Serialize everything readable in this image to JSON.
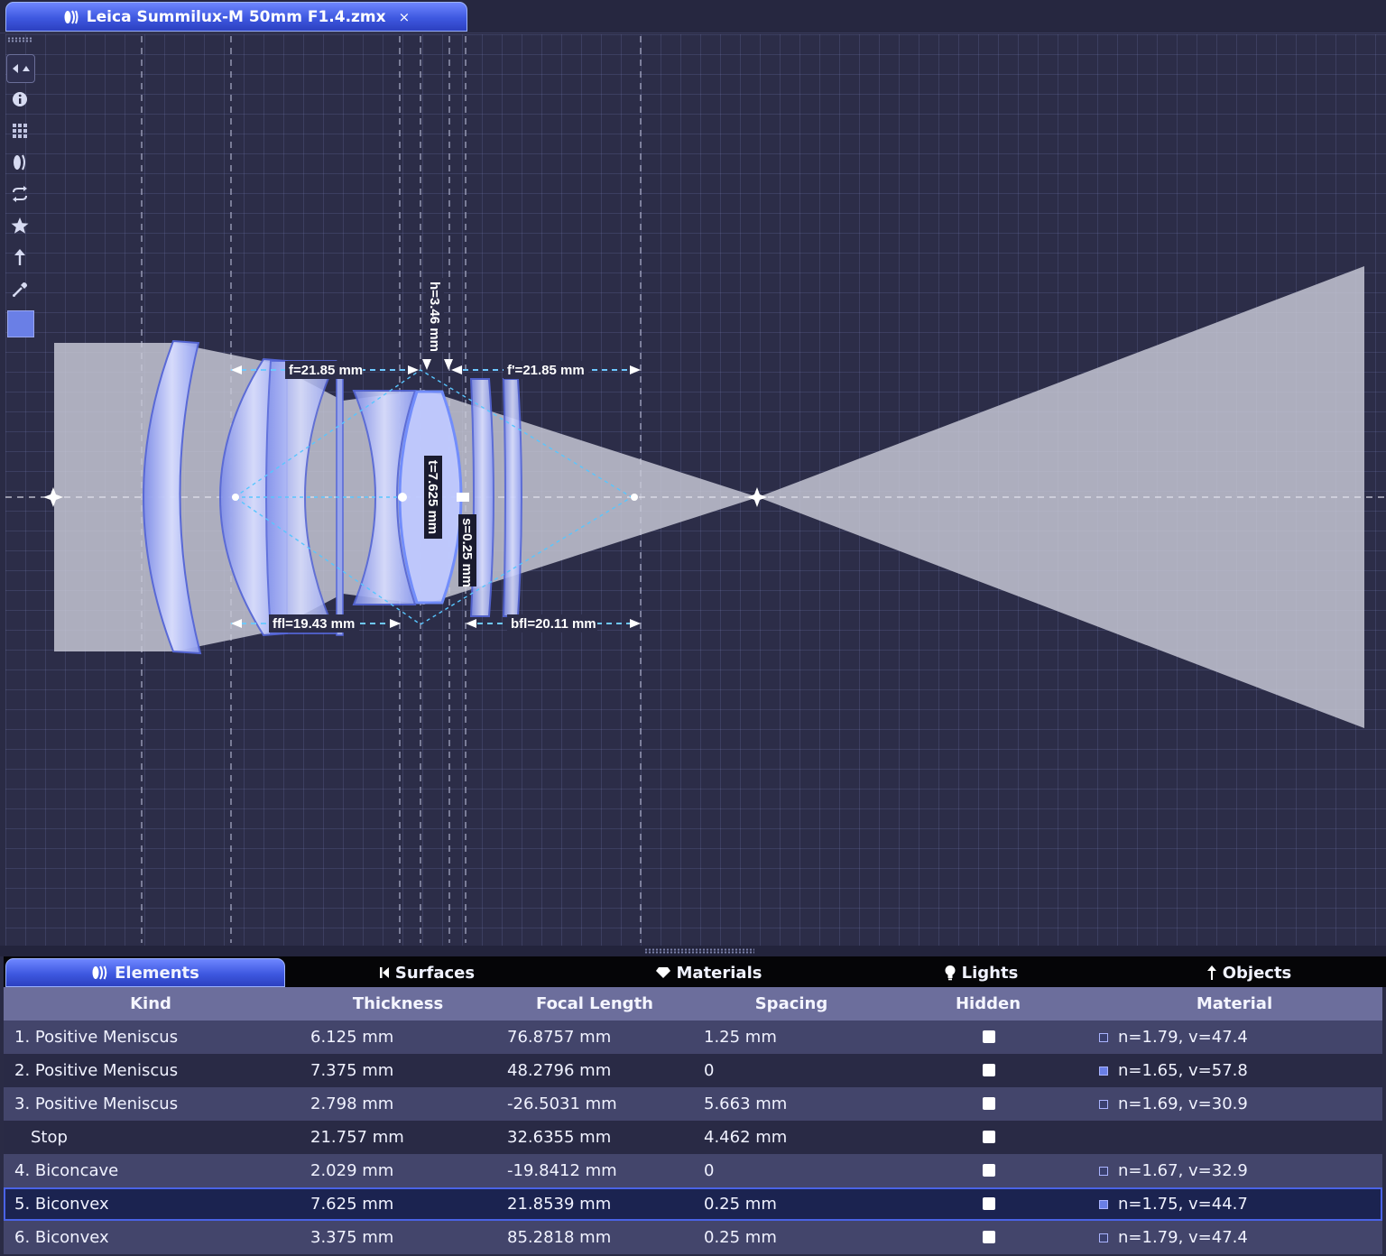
{
  "window": {
    "doc_tab_title": "Leica Summilux-M 50mm F1.4.zmx",
    "doc_tab_close": "×"
  },
  "toolbar": {
    "tools": [
      "arrows-icon",
      "info-icon",
      "grid-icon",
      "lens-icon",
      "swap-icon",
      "star-icon",
      "arrow-up-icon",
      "eyedropper-icon"
    ],
    "current_color": "#6a7fe6"
  },
  "canvas": {
    "annotations": {
      "f": "f=21.85 mm",
      "f_prime": "f'=21.85 mm",
      "h": "h=3.46 mm",
      "t": "t=7.625 mm",
      "s": "s=0.25 mm",
      "ffl": "ffl=19.43 mm",
      "bfl": "bfl=20.11 mm"
    }
  },
  "panel": {
    "tabs": [
      {
        "label": "Elements",
        "icon": "lens-icon",
        "active": true
      },
      {
        "label": "Surfaces",
        "icon": "surface-icon",
        "active": false
      },
      {
        "label": "Materials",
        "icon": "gem-icon",
        "active": false
      },
      {
        "label": "Lights",
        "icon": "bulb-icon",
        "active": false
      },
      {
        "label": "Objects",
        "icon": "arrow-up-icon",
        "active": false
      }
    ],
    "columns": [
      "Kind",
      "Thickness",
      "Focal Length",
      "Spacing",
      "Hidden",
      "Material"
    ],
    "rows": [
      {
        "kind": "1. Positive Meniscus",
        "thickness": "6.125 mm",
        "focal": "76.8757 mm",
        "spacing": "1.25 mm",
        "hidden": false,
        "material": "n=1.79, v=47.4"
      },
      {
        "kind": "2. Positive Meniscus",
        "thickness": "7.375 mm",
        "focal": "48.2796 mm",
        "spacing": "0",
        "hidden": false,
        "material": "n=1.65, v=57.8"
      },
      {
        "kind": "3. Positive Meniscus",
        "thickness": "2.798 mm",
        "focal": "-26.5031 mm",
        "spacing": "5.663 mm",
        "hidden": false,
        "material": "n=1.69, v=30.9"
      },
      {
        "kind": "Stop",
        "thickness": "21.757 mm",
        "focal": "32.6355 mm",
        "spacing": "4.462 mm",
        "hidden": false,
        "material": ""
      },
      {
        "kind": "4. Biconcave",
        "thickness": "2.029 mm",
        "focal": "-19.8412 mm",
        "spacing": "0",
        "hidden": false,
        "material": "n=1.67, v=32.9"
      },
      {
        "kind": "5. Biconvex",
        "thickness": "7.625 mm",
        "focal": "21.8539 mm",
        "spacing": "0.25 mm",
        "hidden": false,
        "material": "n=1.75, v=44.7",
        "selected": true
      },
      {
        "kind": "6. Biconvex",
        "thickness": "3.375 mm",
        "focal": "85.2818 mm",
        "spacing": "0.25 mm",
        "hidden": false,
        "material": "n=1.79, v=47.4"
      }
    ]
  },
  "colors": {
    "accent": "#4a63e6",
    "canvas_bg": "#2c2d48",
    "lens_fill": "#aab6ff",
    "beam": "#c8c9d6"
  }
}
